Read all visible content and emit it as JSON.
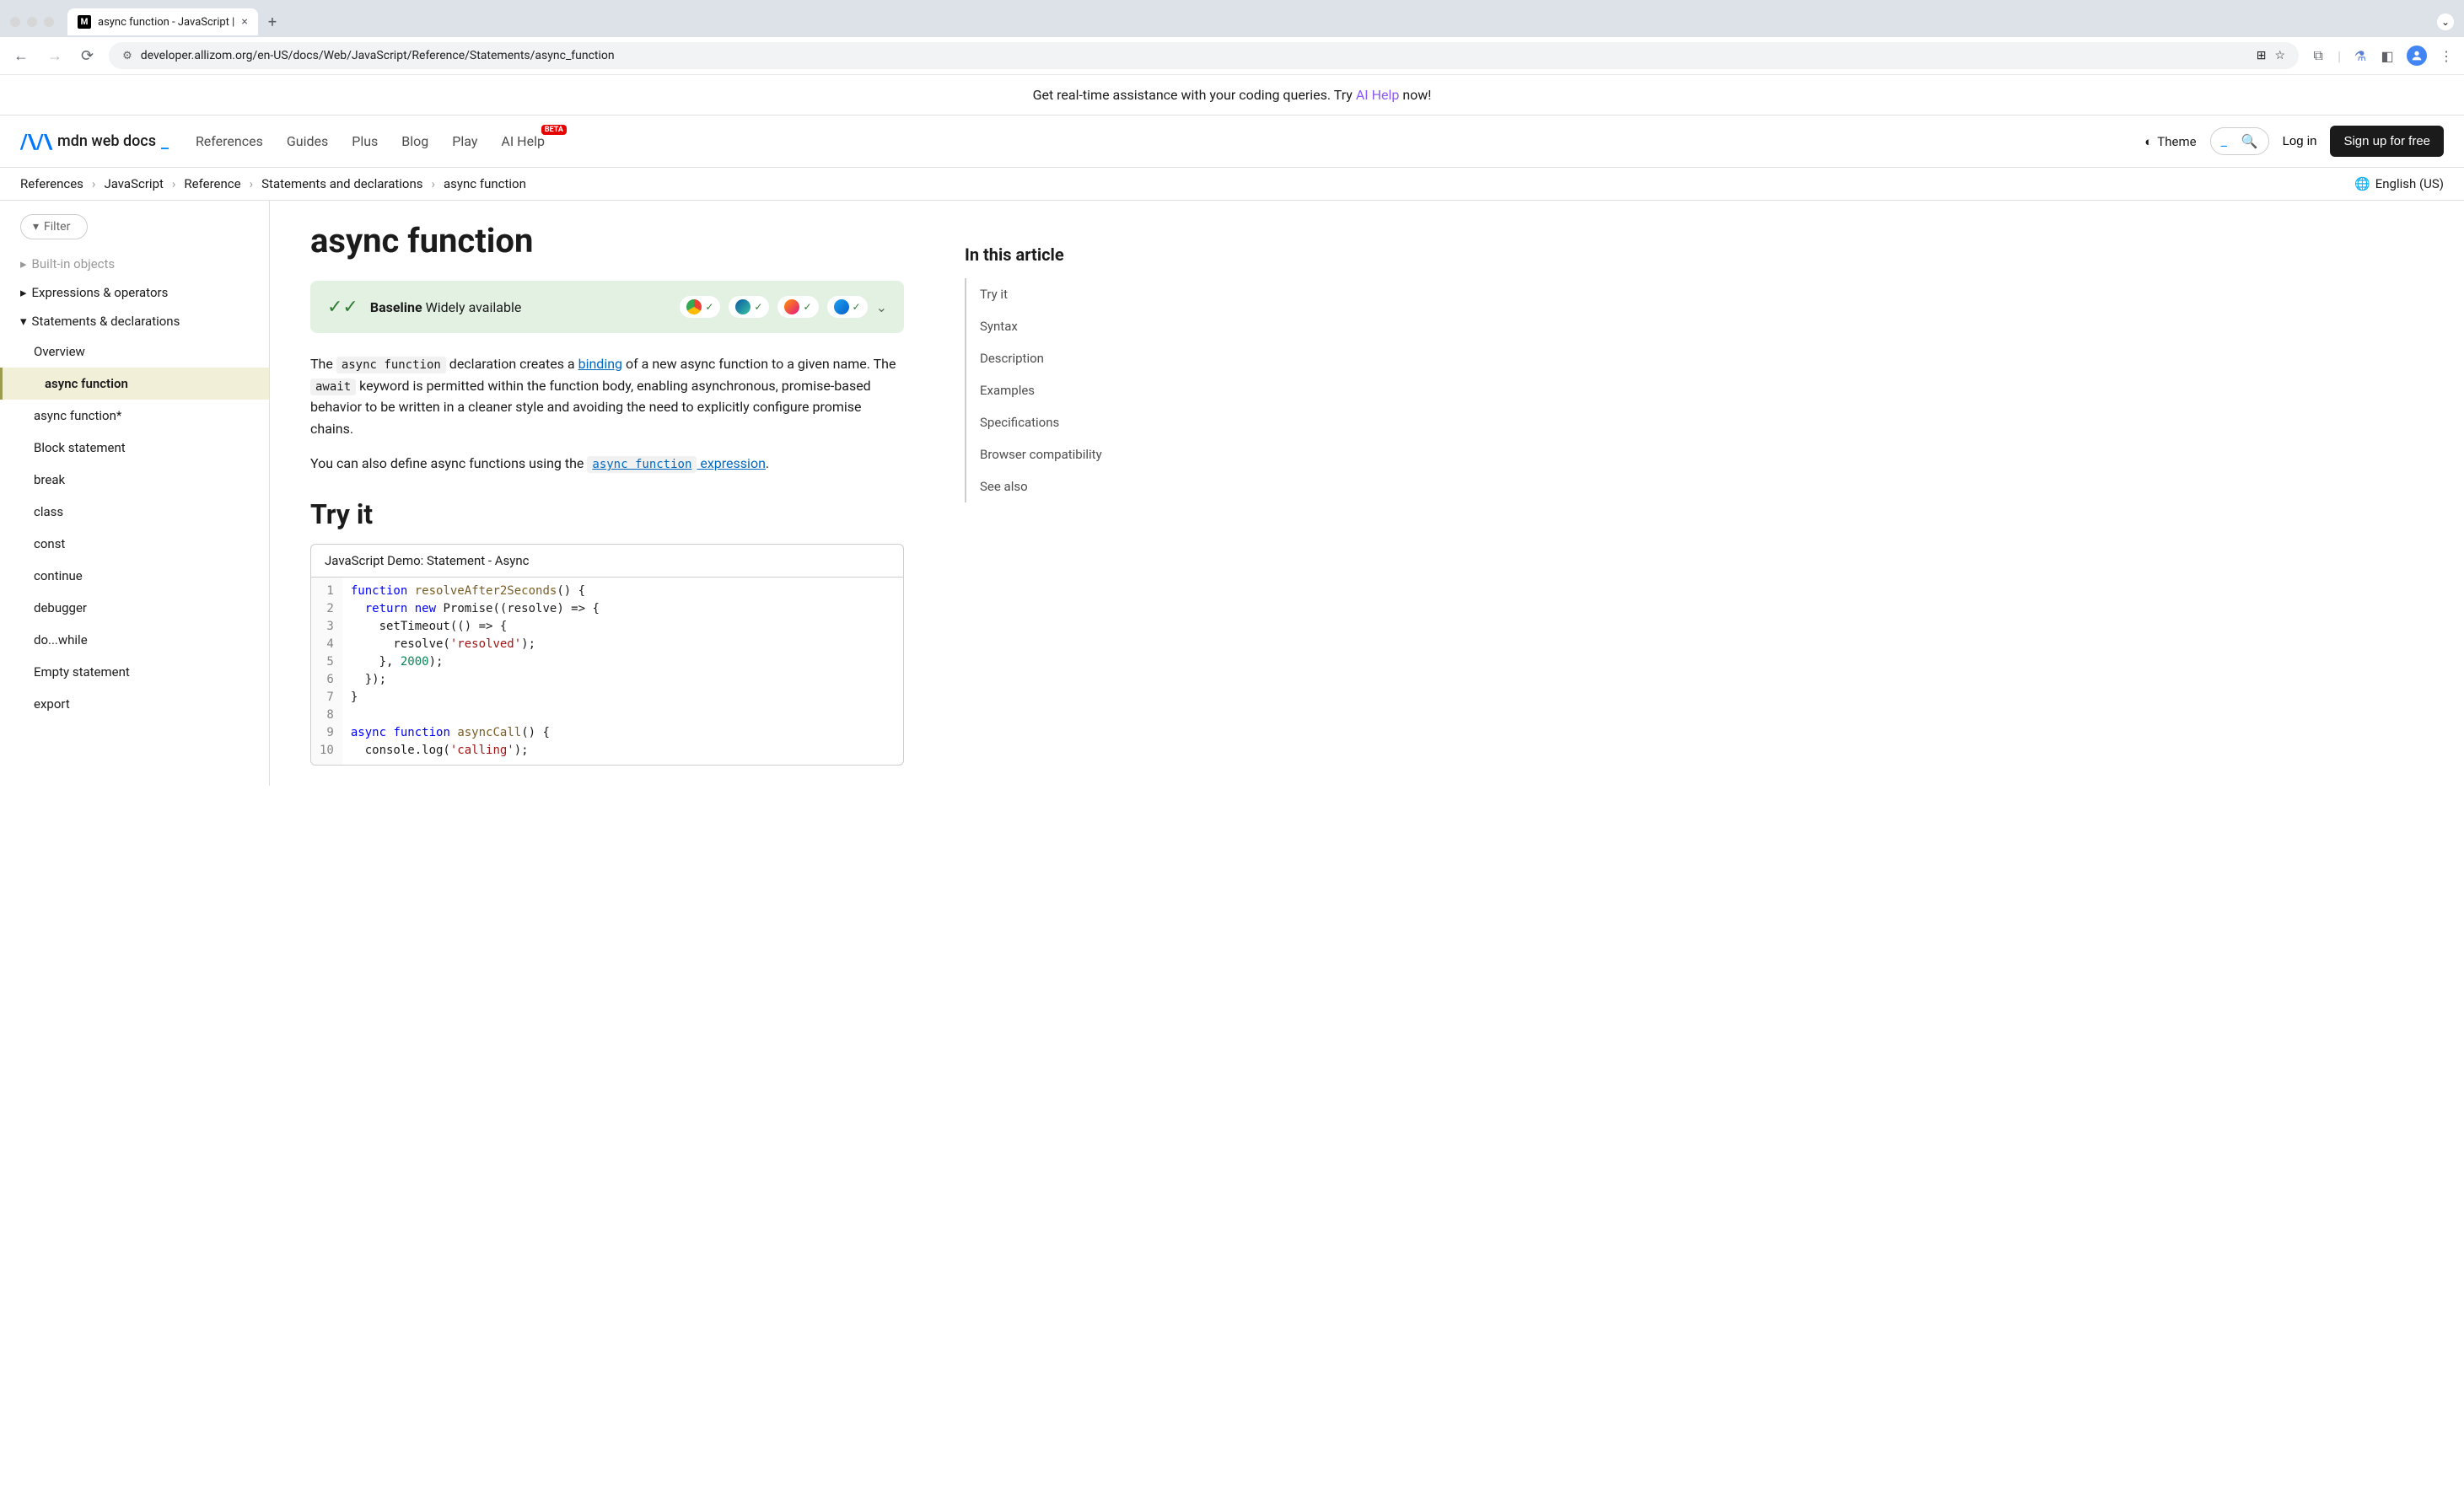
{
  "browser": {
    "tab_title": "async function - JavaScript |",
    "url": "developer.allizom.org/en-US/docs/Web/JavaScript/Reference/Statements/async_function"
  },
  "banner": {
    "text_before": "Get real-time assistance with your coding queries. Try ",
    "link": "AI Help",
    "text_after": " now!"
  },
  "header": {
    "logo": "mdn web docs",
    "nav": [
      "References",
      "Guides",
      "Plus",
      "Blog",
      "Play",
      "AI Help"
    ],
    "beta": "BETA",
    "theme": "Theme",
    "login": "Log in",
    "signup": "Sign up for free"
  },
  "breadcrumb": [
    "References",
    "JavaScript",
    "Reference",
    "Statements and declarations",
    "async function"
  ],
  "lang": "English (US)",
  "sidebar": {
    "filter": "Filter",
    "sections": {
      "builtin": "Built-in objects",
      "expressions": "Expressions & operators",
      "statements": "Statements & declarations"
    },
    "items": [
      "Overview",
      "async function",
      "async function*",
      "Block statement",
      "break",
      "class",
      "const",
      "continue",
      "debugger",
      "do...while",
      "Empty statement",
      "export"
    ]
  },
  "page": {
    "title": "async function",
    "baseline_label": "Baseline",
    "baseline_status": "Widely available",
    "intro_p1_a": "The ",
    "intro_p1_code1": "async function",
    "intro_p1_b": " declaration creates a ",
    "intro_p1_link1": "binding",
    "intro_p1_c": " of a new async function to a given name. The ",
    "intro_p1_code2": "await",
    "intro_p1_d": " keyword is permitted within the function body, enabling asynchronous, promise-based behavior to be written in a cleaner style and avoiding the need to explicitly configure promise chains.",
    "intro_p2_a": "You can also define async functions using the ",
    "intro_p2_link_code": "async function",
    "intro_p2_link_text": " expression",
    "intro_p2_b": ".",
    "tryit_heading": "Try it",
    "demo_title": "JavaScript Demo: Statement - Async",
    "code_lines": [
      {
        "n": 1,
        "tokens": [
          {
            "t": "function",
            "c": "kw"
          },
          {
            "t": " "
          },
          {
            "t": "resolveAfter2Seconds",
            "c": "fn"
          },
          {
            "t": "() {"
          }
        ]
      },
      {
        "n": 2,
        "tokens": [
          {
            "t": "  "
          },
          {
            "t": "return",
            "c": "kw"
          },
          {
            "t": " "
          },
          {
            "t": "new",
            "c": "kw"
          },
          {
            "t": " Promise((resolve) => {"
          }
        ]
      },
      {
        "n": 3,
        "tokens": [
          {
            "t": "    setTimeout(() => {"
          }
        ]
      },
      {
        "n": 4,
        "tokens": [
          {
            "t": "      resolve("
          },
          {
            "t": "'resolved'",
            "c": "str"
          },
          {
            "t": ");"
          }
        ]
      },
      {
        "n": 5,
        "tokens": [
          {
            "t": "    }, "
          },
          {
            "t": "2000",
            "c": "num"
          },
          {
            "t": ");"
          }
        ]
      },
      {
        "n": 6,
        "tokens": [
          {
            "t": "  });"
          }
        ]
      },
      {
        "n": 7,
        "tokens": [
          {
            "t": "}"
          }
        ]
      },
      {
        "n": 8,
        "tokens": [
          {
            "t": ""
          }
        ]
      },
      {
        "n": 9,
        "tokens": [
          {
            "t": "async",
            "c": "kw"
          },
          {
            "t": " "
          },
          {
            "t": "function",
            "c": "kw"
          },
          {
            "t": " "
          },
          {
            "t": "asyncCall",
            "c": "fn"
          },
          {
            "t": "() {"
          }
        ]
      },
      {
        "n": 10,
        "tokens": [
          {
            "t": "  console.log("
          },
          {
            "t": "'calling'",
            "c": "str"
          },
          {
            "t": ");"
          }
        ]
      }
    ]
  },
  "toc": {
    "heading": "In this article",
    "items": [
      "Try it",
      "Syntax",
      "Description",
      "Examples",
      "Specifications",
      "Browser compatibility",
      "See also"
    ]
  }
}
